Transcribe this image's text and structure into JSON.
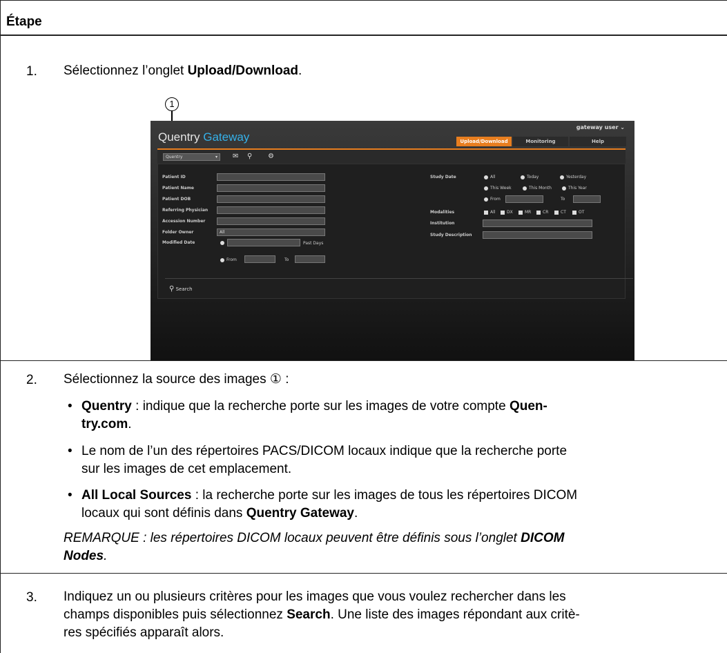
{
  "header": {
    "title": "Étape"
  },
  "steps": [
    {
      "num": "1.",
      "text_pre": "Sélectionnez l’onglet ",
      "text_bold": "Upload/Download",
      "text_post": "."
    },
    {
      "num": "2.",
      "text": "Sélectionnez la source des images ① :"
    },
    {
      "num": "3.",
      "line1_pre": "Indiquez un ou plusieurs critères pour les images que vous voulez rechercher dans les",
      "line2_pre": "champs disponibles puis sélectionnez ",
      "line2_bold": "Search",
      "line2_post": ". Une liste des images répondant aux critè-",
      "line3": "res spécifiés apparaît alors."
    }
  ],
  "bullets": [
    {
      "bold": "Quentry",
      "text": " : indique que la recherche porte sur les images de votre compte ",
      "bold2": "Quen-",
      "line2_bold": "try.com",
      "line2_post": "."
    },
    {
      "line1": "Le nom de l’un des répertoires PACS/DICOM locaux indique que la recherche porte",
      "line2": "sur les images de cet emplacement."
    },
    {
      "bold": "All Local Sources",
      "text": " : la recherche porte sur les images de tous les répertoires DICOM",
      "line2_pre": "locaux qui sont définis dans ",
      "line2_bold": "Quentry Gateway",
      "line2_post": "."
    }
  ],
  "remark": {
    "line1_pre": "REMARQUE : les répertoires DICOM locaux peuvent être définis sous l’onglet ",
    "line1_bold": "DICOM",
    "line2_bold": "Nodes",
    "line2_post": "."
  },
  "callout": "1",
  "app": {
    "brand1": "Quentry",
    "brand2": "Gateway",
    "user": "gateway user ⌄",
    "tabs": [
      "Upload/Download",
      "Monitoring",
      "Help"
    ],
    "source": "Quentry",
    "labels_left": [
      "Patient ID",
      "Patient Name",
      "Patient DOB",
      "Referring Physician",
      "Accession Number",
      "Folder Owner",
      "Modified Date"
    ],
    "folder_owner": "All",
    "past_days": "Past Days",
    "from": "From",
    "to": "To",
    "study_date": "Study Date",
    "date_opts": [
      "All",
      "Today",
      "Yesterday",
      "This Week",
      "This Month",
      "This Year"
    ],
    "modalities_label": "Modalities",
    "modalities": [
      "All",
      "DX",
      "MR",
      "CR",
      "CT",
      "OT"
    ],
    "institution": "Institution",
    "study_description": "Study Description",
    "search": "Search"
  },
  "colors": {
    "accent": "#e87e1f",
    "brand": "#35b0e8"
  }
}
